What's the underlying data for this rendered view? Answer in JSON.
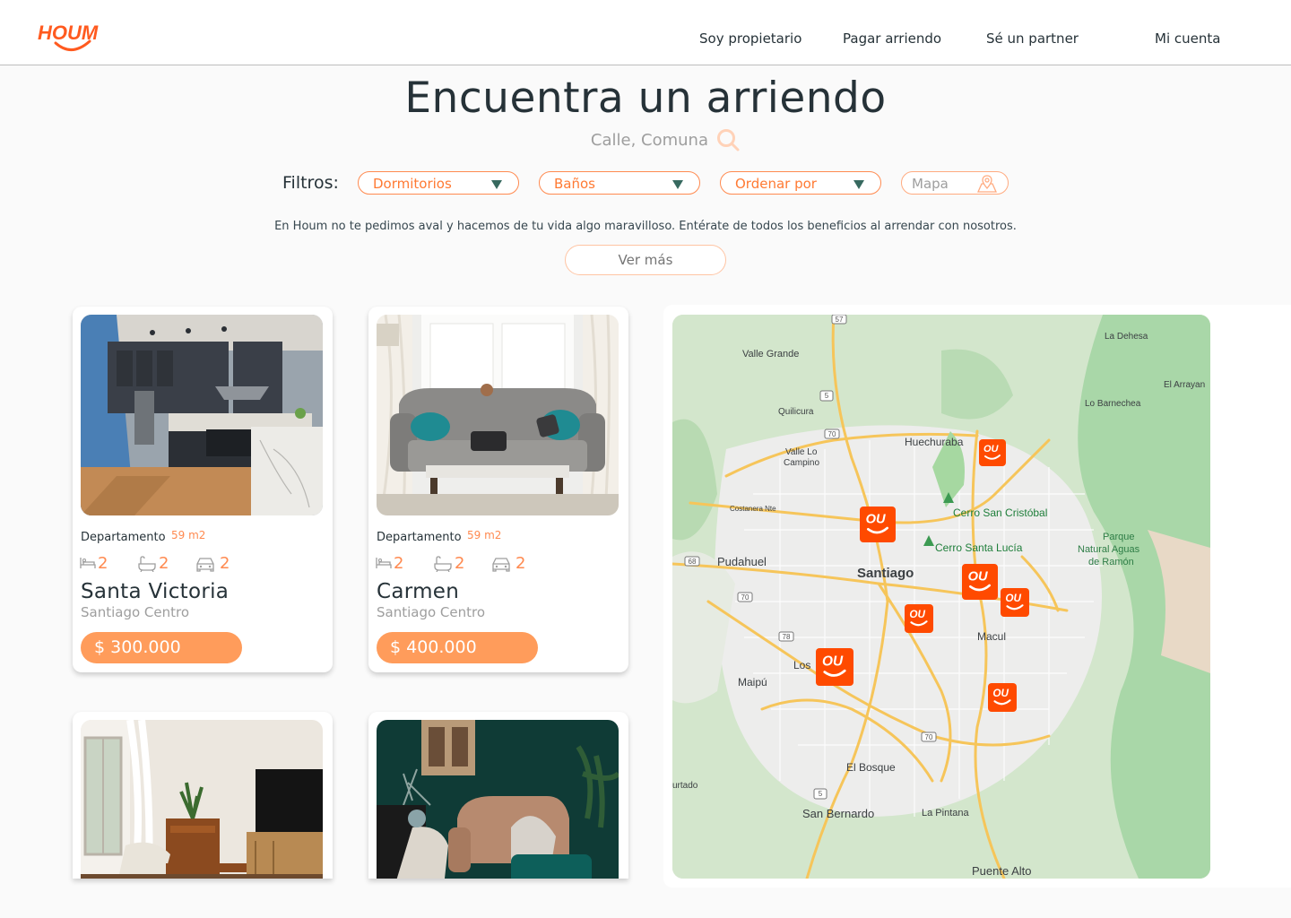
{
  "brand": {
    "name": "HOUM",
    "accent": "#ff5a1f",
    "secondary_accent": "#ff9c5b"
  },
  "nav": {
    "owner": "Soy propietario",
    "pay_rent": "Pagar arriendo",
    "partner": "Sé un  partner",
    "account": "Mi cuenta"
  },
  "hero": {
    "title": "Encuentra un arriendo",
    "search_placeholder": "Calle, Comuna"
  },
  "filters": {
    "label": "Filtros:",
    "bedrooms": "Dormitorios",
    "bathrooms": "Baños",
    "sort": "Ordenar por",
    "map": "Mapa"
  },
  "info": {
    "text": "En Houm no te pedimos aval y hacemos de tu vida algo maravilloso. Entérate de todos los beneficios al arrendar con nosotros.",
    "more": "Ver más"
  },
  "listings": [
    {
      "type": "Departamento",
      "area": "59 m2",
      "bedrooms": "2",
      "bathrooms": "2",
      "parking": "2",
      "name": "Santa Victoria",
      "location": "Santiago Centro",
      "price": "$ 300.000",
      "photo": "kitchen"
    },
    {
      "type": "Departamento",
      "area": "59 m2",
      "bedrooms": "2",
      "bathrooms": "2",
      "parking": "2",
      "name": "Carmen",
      "location": "Santiago Centro",
      "price": "$ 400.000",
      "photo": "living-room-sofa"
    },
    {
      "photo": "living-room-tv"
    },
    {
      "photo": "living-room-green-wall"
    }
  ],
  "map": {
    "labels": {
      "valle_grande": "Valle Grande",
      "la_dehesa": "La Dehesa",
      "el_arrayan": "El Arrayan",
      "lo_barnechea": "Lo Barnechea",
      "quilicura": "Quilicura",
      "huechuraba": "Huechuraba",
      "valle_lo_campino_1": "Valle Lo",
      "valle_lo_campino_2": "Campino",
      "costanera_norte": "Costanera Nte",
      "cerro_san_cristobal": "Cerro San Cristóbal",
      "cerro_santa_lucia": "Cerro Santa Lucía",
      "parque_1": "Parque",
      "parque_2": "Natural Aguas",
      "parque_3": "de Ramón",
      "pudahuel": "Pudahuel",
      "santiago": "Santiago",
      "macul": "Macul",
      "los_cerrillos": "Los",
      "maipu": "Maipú",
      "el_bosque": "El Bosque",
      "san_bernardo": "San Bernardo",
      "la_pintana": "La Pintana",
      "puente_alto": "Puente Alto",
      "hurtado": "urtado"
    },
    "route_shields": [
      "57",
      "5",
      "70",
      "68",
      "70",
      "78",
      "70",
      "5"
    ]
  }
}
